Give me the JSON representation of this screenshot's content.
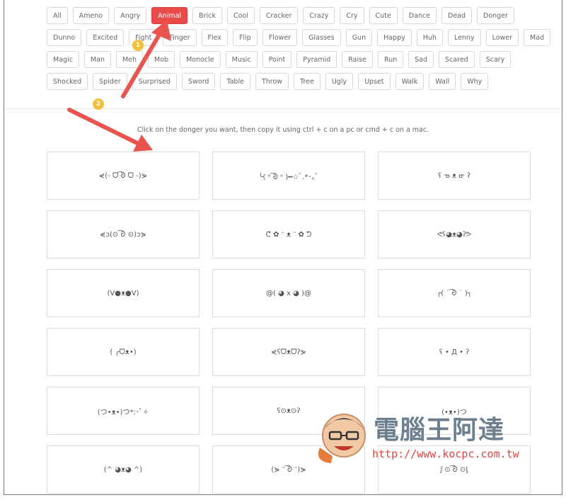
{
  "tag_rows": [
    [
      "All",
      "Ameno",
      "Angry",
      "Animal",
      "Brick",
      "Cool",
      "Cracker",
      "Crazy",
      "Cry",
      "Cute",
      "Dance",
      "Dead",
      "Donger"
    ],
    [
      "Dunno",
      "Excited",
      "Fight",
      "Finger",
      "Flex",
      "Flip",
      "Flower",
      "Glasses",
      "Gun",
      "Happy",
      "Huh",
      "Lenny",
      "Lower",
      "Mad"
    ],
    [
      "Magic",
      "Man",
      "Meh",
      "Mob",
      "Monocle",
      "Music",
      "Point",
      "Pyramid",
      "Raise",
      "Run",
      "Sad",
      "Scared",
      "Scary"
    ],
    [
      "Shocked",
      "Spider",
      "Surprised",
      "Sword",
      "Table",
      "Throw",
      "Tree",
      "Ugly",
      "Upset",
      "Walk",
      "Wall",
      "Why"
    ]
  ],
  "active_tag": "Animal",
  "instructions": "Click on the donger you want, then copy it using ctrl + c on a pc or cmd + c on a mac.",
  "dongers": [
    [
      "⋞(- ᗜ ͡ᘐ ᗜ -)⋟",
      "╰( ᵒ ͡ᘐ ᵒ )━☆ﾟ.*･｡ﾟ",
      "ʕ ᓀ ᴥ ᓂ ʔ"
    ],
    [
      "⋞ɔ(⊙ ͡ᘐ ⊙)ɔ⋟",
      "ᕦ ✿ ᵔ ᴥ ᵔ ✿ ᕤ",
      "ᕙʕ◕ᴥ◕ʔᕗ"
    ],
    [
      "(V●ᴥ●V)",
      "@( ◕ x ◕ )@",
      "┌( ˙ ͡ᘐ ˙ )┐"
    ],
    [
      "( ╭ᗜᴥ•)",
      "⋞ʕᗜᴥᗜʔ⋟",
      "ʕ • Д • ʔ"
    ],
    [
      "(つ•ᴥ•)つ*:･ﾟ✧",
      "ʕ⊙ᴥ⊙ʔ",
      "(•ᴥ•)つ"
    ],
    [
      "(^ ◕ᴥ◕ ^)",
      "(⋟ ᵔ ͡ᘐ ᵔ)⋟",
      "ᶘ ⊙ ͡ᘐ ⊙ᶅ"
    ]
  ],
  "markers": [
    "1",
    "2"
  ],
  "watermark": {
    "name": "電腦王阿達",
    "url": "http://www.kocpc.com.tw"
  },
  "colors": {
    "accent": "#e94b4b",
    "arrow": "#e8554e",
    "marker": "#f2c03c"
  }
}
